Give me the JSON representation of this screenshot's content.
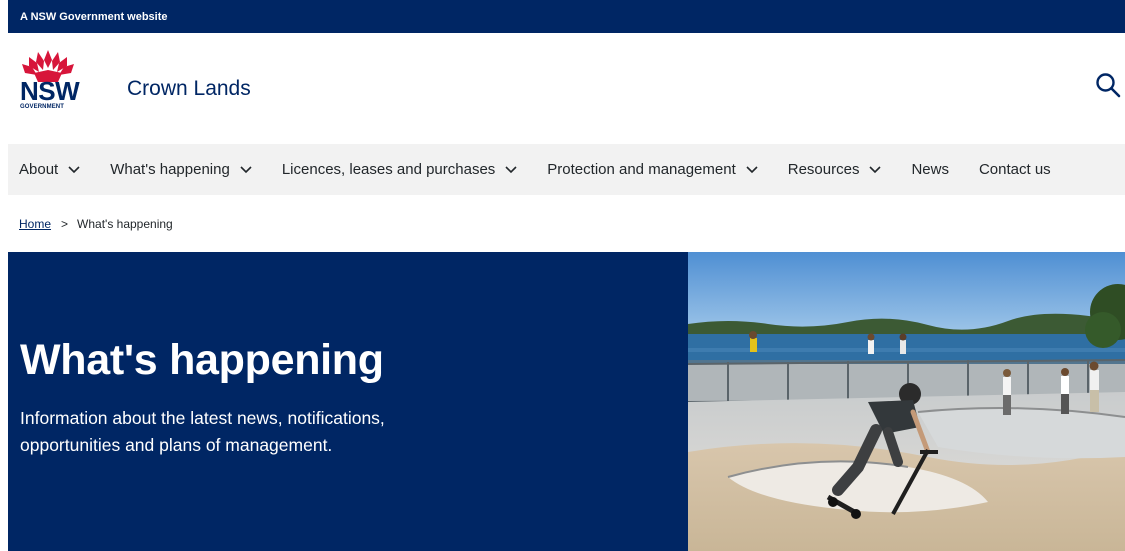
{
  "masthead": {
    "text": "A NSW Government website"
  },
  "header": {
    "logo": {
      "nsw": "NSW",
      "government": "GOVERNMENT"
    },
    "site_name": "Crown Lands",
    "search_icon": "search-icon"
  },
  "nav": {
    "items": [
      {
        "label": "About",
        "has_dropdown": true
      },
      {
        "label": "What's happening",
        "has_dropdown": true
      },
      {
        "label": "Licences, leases and purchases",
        "has_dropdown": true
      },
      {
        "label": "Protection and management",
        "has_dropdown": true
      },
      {
        "label": "Resources",
        "has_dropdown": true
      },
      {
        "label": "News",
        "has_dropdown": false
      },
      {
        "label": "Contact us",
        "has_dropdown": false
      }
    ]
  },
  "breadcrumb": {
    "home": "Home",
    "separator": ">",
    "current": "What's happening"
  },
  "hero": {
    "title": "What's happening",
    "description": "Information about the latest news, notifications, opportunities and plans of management."
  },
  "colors": {
    "brand_navy": "#002664",
    "brand_red": "#d7153a",
    "nav_bg": "#f2f2f2"
  }
}
